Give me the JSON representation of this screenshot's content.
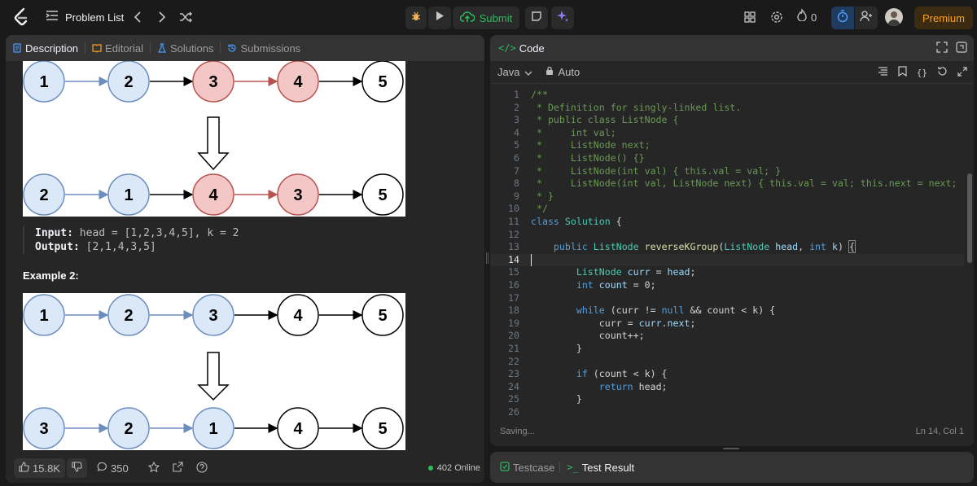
{
  "topbar": {
    "problem_list_label": "Problem List",
    "submit_label": "Submit",
    "streak_count": "0",
    "premium_label": "Premium"
  },
  "left_tabs": [
    {
      "label": "Description",
      "icon": "description-icon"
    },
    {
      "label": "Editorial",
      "icon": "book-icon"
    },
    {
      "label": "Solutions",
      "icon": "flask-icon"
    },
    {
      "label": "Submissions",
      "icon": "history-icon"
    }
  ],
  "example1": {
    "figure_rows": [
      [
        "1",
        "2",
        "3",
        "4",
        "5"
      ],
      [
        "2",
        "1",
        "4",
        "3",
        "5"
      ]
    ],
    "input_label": "Input:",
    "input_value": "head = [1,2,3,4,5], k = 2",
    "output_label": "Output:",
    "output_value": "[2,1,4,3,5]"
  },
  "example2": {
    "heading": "Example 2:",
    "figure_rows": [
      [
        "1",
        "2",
        "3",
        "4",
        "5"
      ],
      [
        "3",
        "2",
        "1",
        "4",
        "5"
      ]
    ]
  },
  "footer": {
    "likes": "15.8K",
    "comments": "350",
    "online": "402 Online"
  },
  "code_panel": {
    "title": "Code",
    "language": "Java",
    "mode": "Auto",
    "status_left": "Saving...",
    "status_right": "Ln 14, Col 1"
  },
  "code_lines": [
    "/**",
    " * Definition for singly-linked list.",
    " * public class ListNode {",
    " *     int val;",
    " *     ListNode next;",
    " *     ListNode() {}",
    " *     ListNode(int val) { this.val = val; }",
    " *     ListNode(int val, ListNode next) { this.val = val; this.next = next; }",
    " * }",
    " */",
    "class Solution {",
    "",
    "    public ListNode reverseKGroup(ListNode head, int k) {",
    "",
    "        ListNode curr = head;",
    "        int count = 0;",
    "",
    "        while (curr != null && count < k) {",
    "            curr = curr.next;",
    "            count++;",
    "        }",
    "",
    "        if (count < k) {",
    "            return head;",
    "        }",
    ""
  ],
  "bottom_tabs": [
    {
      "label": "Testcase",
      "icon": "checkbox-icon"
    },
    {
      "label": "Test Result",
      "icon": "terminal-icon"
    }
  ],
  "colors": {
    "accent_orange": "#ffa116",
    "submit_green": "#2cbb5d",
    "node_blue": "#dbe8f8",
    "node_red": "#f4c7c7"
  }
}
